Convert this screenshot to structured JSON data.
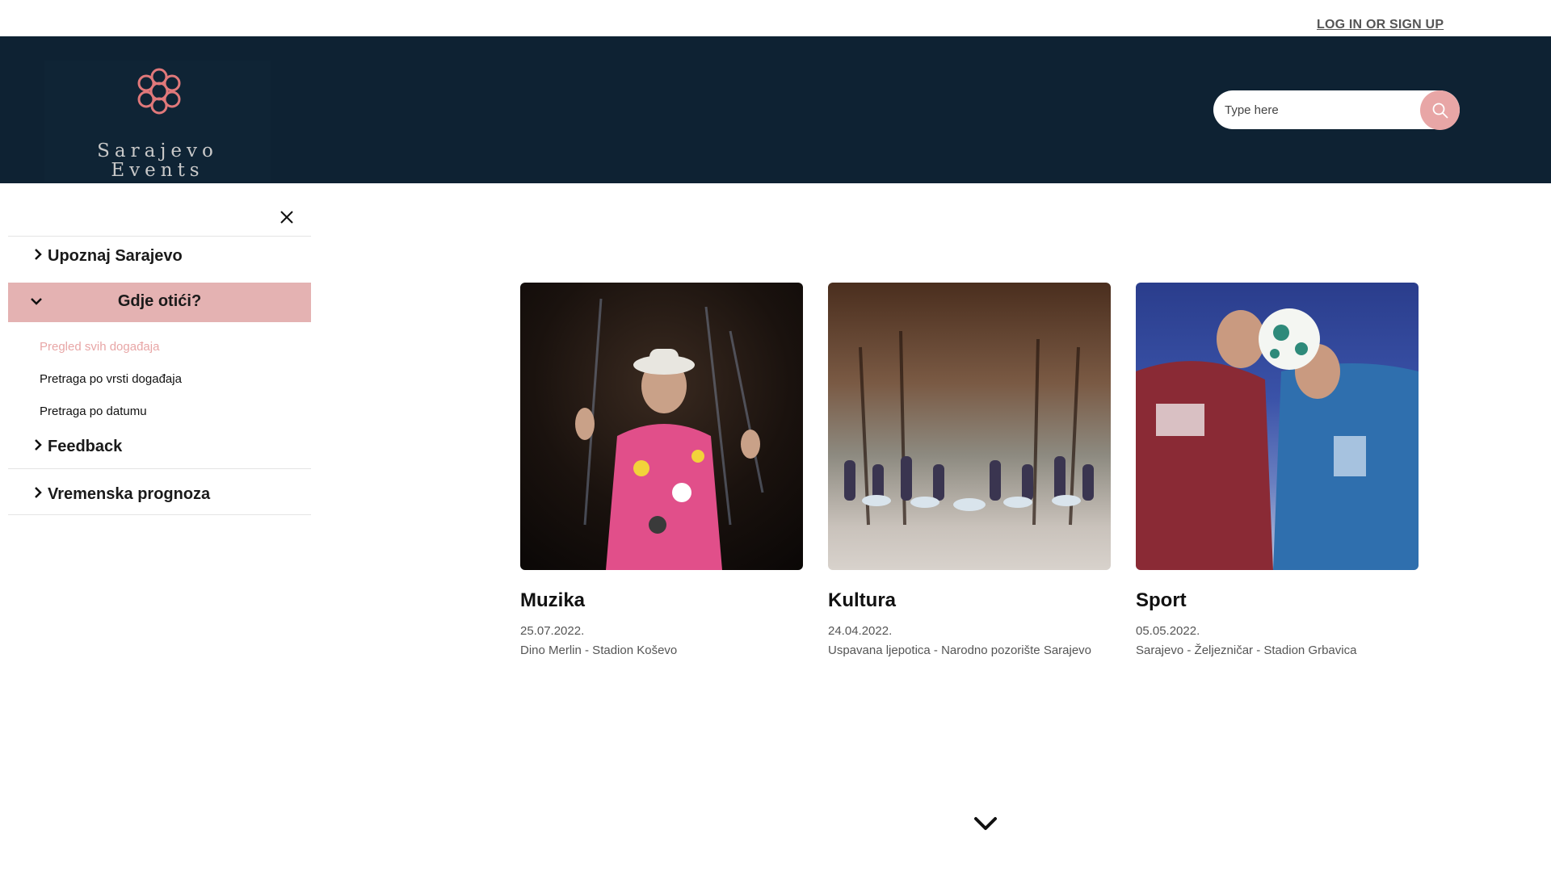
{
  "top_nav": {
    "login_label": "LOG IN OR SIGN UP"
  },
  "brand": {
    "line1": "Sarajevo",
    "line2": "Events"
  },
  "search": {
    "placeholder": "Type here"
  },
  "sidebar": {
    "items": [
      {
        "label": "Upoznaj Sarajevo",
        "expanded": false
      },
      {
        "label": "Gdje otići?",
        "expanded": true,
        "subitems": [
          {
            "label": "Pregled svih događaja",
            "active": true
          },
          {
            "label": "Pretraga po vrsti događaja",
            "active": false
          },
          {
            "label": "Pretraga po datumu",
            "active": false
          }
        ]
      },
      {
        "label": "Feedback",
        "expanded": false
      },
      {
        "label": "Vremenska prognoza",
        "expanded": false
      }
    ]
  },
  "cards": [
    {
      "title": "Muzika",
      "date": "25.07.2022.",
      "desc": "Dino Merlin - Stadion Koševo"
    },
    {
      "title": "Kultura",
      "date": "24.04.2022.",
      "desc": "Uspavana ljepotica - Narodno pozorište Sarajevo"
    },
    {
      "title": "Sport",
      "date": "05.05.2022.",
      "desc": "Sarajevo - Željezničar - Stadion Grbavica"
    }
  ],
  "colors": {
    "header_bg": "#0e2233",
    "accent_pink": "#e8a6a6",
    "active_item_bg": "#e4b2b2"
  },
  "icons": {
    "search": "search-icon",
    "close": "close-icon",
    "chevron_right": "chevron-right-icon",
    "chevron_down": "chevron-down-icon"
  }
}
